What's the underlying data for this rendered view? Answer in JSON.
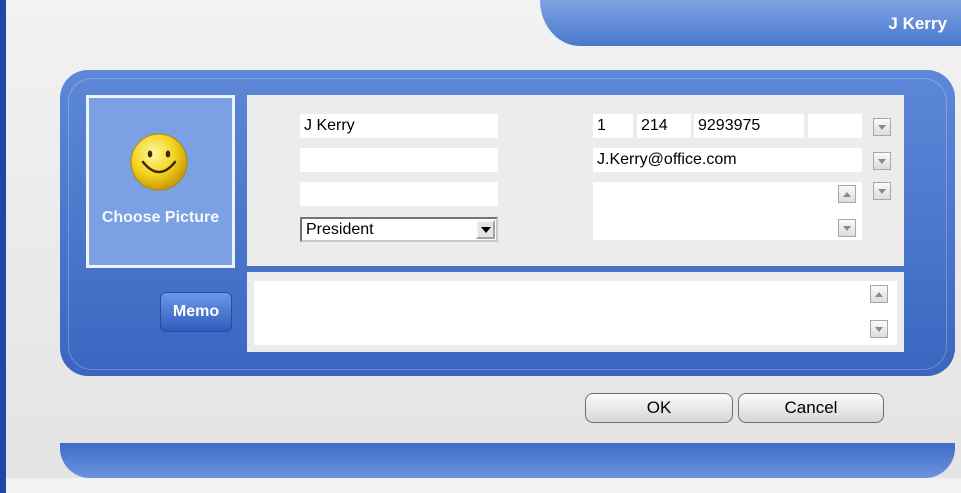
{
  "window": {
    "title": "J Kerry"
  },
  "picture": {
    "label": "Choose Picture",
    "icon": "smiley-face-icon"
  },
  "contact": {
    "name": "J Kerry",
    "field2": "",
    "field3": "",
    "job_title": "President",
    "phone": {
      "country": "1",
      "area": "214",
      "number": "9293975",
      "ext": ""
    },
    "email": "J.Kerry@office.com",
    "address": ""
  },
  "memo": {
    "label": "Memo",
    "text": ""
  },
  "buttons": {
    "ok": "OK",
    "cancel": "Cancel"
  },
  "colors": {
    "accent_blue": "#3a66c0",
    "title_tab": "#4a78cf",
    "picture_bg": "#7ca0e4"
  }
}
